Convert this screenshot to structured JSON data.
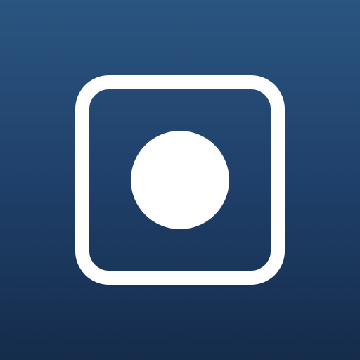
{
  "app_icon": {
    "icon_name": "record-button-icon",
    "glyph": "rounded-square-with-dot",
    "colors": {
      "background_top": "#2a5580",
      "background_mid": "#1f406a",
      "background_bottom": "#152c4b",
      "glyph": "#ffffff"
    }
  }
}
